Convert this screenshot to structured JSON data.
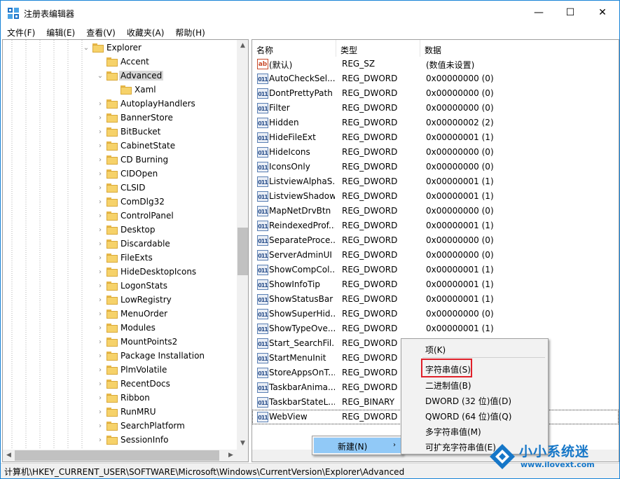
{
  "window": {
    "title": "注册表编辑器",
    "controls": {
      "minimize": "—",
      "maximize": "☐",
      "close": "✕"
    }
  },
  "menubar": [
    "文件(F)",
    "编辑(E)",
    "查看(V)",
    "收藏夹(A)",
    "帮助(H)"
  ],
  "tree": {
    "parent": "Explorer",
    "selected": "Advanced",
    "child": "Xaml",
    "siblings_before": [
      "Accent"
    ],
    "siblings_after": [
      "AutoplayHandlers",
      "BannerStore",
      "BitBucket",
      "CabinetState",
      "CD Burning",
      "CIDOpen",
      "CLSID",
      "ComDlg32",
      "ControlPanel",
      "Desktop",
      "Discardable",
      "FileExts",
      "HideDesktopIcons",
      "LogonStats",
      "LowRegistry",
      "MenuOrder",
      "Modules",
      "MountPoints2",
      "Package Installation",
      "PlmVolatile",
      "RecentDocs",
      "Ribbon",
      "RunMRU",
      "SearchPlatform",
      "SessionInfo"
    ]
  },
  "list": {
    "columns": {
      "name": "名称",
      "type": "类型",
      "data": "数据"
    },
    "rows": [
      {
        "icon": "string-value-icon",
        "name": "(默认)",
        "type": "REG_SZ",
        "data": "(数值未设置)"
      },
      {
        "icon": "binary-value-icon",
        "name": "AutoCheckSel...",
        "type": "REG_DWORD",
        "data": "0x00000000 (0)"
      },
      {
        "icon": "binary-value-icon",
        "name": "DontPrettyPath",
        "type": "REG_DWORD",
        "data": "0x00000000 (0)"
      },
      {
        "icon": "binary-value-icon",
        "name": "Filter",
        "type": "REG_DWORD",
        "data": "0x00000000 (0)"
      },
      {
        "icon": "binary-value-icon",
        "name": "Hidden",
        "type": "REG_DWORD",
        "data": "0x00000002 (2)"
      },
      {
        "icon": "binary-value-icon",
        "name": "HideFileExt",
        "type": "REG_DWORD",
        "data": "0x00000001 (1)"
      },
      {
        "icon": "binary-value-icon",
        "name": "HideIcons",
        "type": "REG_DWORD",
        "data": "0x00000000 (0)"
      },
      {
        "icon": "binary-value-icon",
        "name": "IconsOnly",
        "type": "REG_DWORD",
        "data": "0x00000000 (0)"
      },
      {
        "icon": "binary-value-icon",
        "name": "ListviewAlphaS...",
        "type": "REG_DWORD",
        "data": "0x00000001 (1)"
      },
      {
        "icon": "binary-value-icon",
        "name": "ListviewShadow",
        "type": "REG_DWORD",
        "data": "0x00000001 (1)"
      },
      {
        "icon": "binary-value-icon",
        "name": "MapNetDrvBtn",
        "type": "REG_DWORD",
        "data": "0x00000000 (0)"
      },
      {
        "icon": "binary-value-icon",
        "name": "ReindexedProf...",
        "type": "REG_DWORD",
        "data": "0x00000001 (1)"
      },
      {
        "icon": "binary-value-icon",
        "name": "SeparateProce...",
        "type": "REG_DWORD",
        "data": "0x00000000 (0)"
      },
      {
        "icon": "binary-value-icon",
        "name": "ServerAdminUI",
        "type": "REG_DWORD",
        "data": "0x00000000 (0)"
      },
      {
        "icon": "binary-value-icon",
        "name": "ShowCompCol...",
        "type": "REG_DWORD",
        "data": "0x00000001 (1)"
      },
      {
        "icon": "binary-value-icon",
        "name": "ShowInfoTip",
        "type": "REG_DWORD",
        "data": "0x00000001 (1)"
      },
      {
        "icon": "binary-value-icon",
        "name": "ShowStatusBar",
        "type": "REG_DWORD",
        "data": "0x00000001 (1)"
      },
      {
        "icon": "binary-value-icon",
        "name": "ShowSuperHid...",
        "type": "REG_DWORD",
        "data": "0x00000000 (0)"
      },
      {
        "icon": "binary-value-icon",
        "name": "ShowTypeOve...",
        "type": "REG_DWORD",
        "data": "0x00000001 (1)"
      },
      {
        "icon": "binary-value-icon",
        "name": "Start_SearchFil...",
        "type": "REG_DWORD",
        "data": ""
      },
      {
        "icon": "binary-value-icon",
        "name": "StartMenuInit",
        "type": "REG_DWORD",
        "data": ""
      },
      {
        "icon": "binary-value-icon",
        "name": "StoreAppsOnT...",
        "type": "REG_DWORD",
        "data": ""
      },
      {
        "icon": "binary-value-icon",
        "name": "TaskbarAnima...",
        "type": "REG_DWORD",
        "data": ""
      },
      {
        "icon": "binary-value-icon",
        "name": "TaskbarStateL...",
        "type": "REG_BINARY",
        "data": ""
      },
      {
        "icon": "binary-value-icon",
        "name": "WebView",
        "type": "REG_DWORD",
        "data": ""
      }
    ]
  },
  "context_menu": {
    "new_label": "新建(N)",
    "new_arrow": "›",
    "items": [
      "项(K)",
      "字符串值(S)",
      "二进制值(B)",
      "DWORD (32 位)值(D)",
      "QWORD (64 位)值(Q)",
      "多字符串值(M)",
      "可扩充字符串值(E)"
    ],
    "highlighted_item": "字符串值(S)",
    "highlight_color": "#e0202a"
  },
  "statusbar": {
    "path": "计算机\\HKEY_CURRENT_USER\\SOFTWARE\\Microsoft\\Windows\\CurrentVersion\\Explorer\\Advanced"
  },
  "watermark": {
    "title": "小小系统迷",
    "url": "www.ilovext.com"
  },
  "colors": {
    "accent": "#1883d7",
    "selection": "#91c9f7",
    "tree_selected": "#d9d9d9",
    "watermark": "#1677c8"
  }
}
